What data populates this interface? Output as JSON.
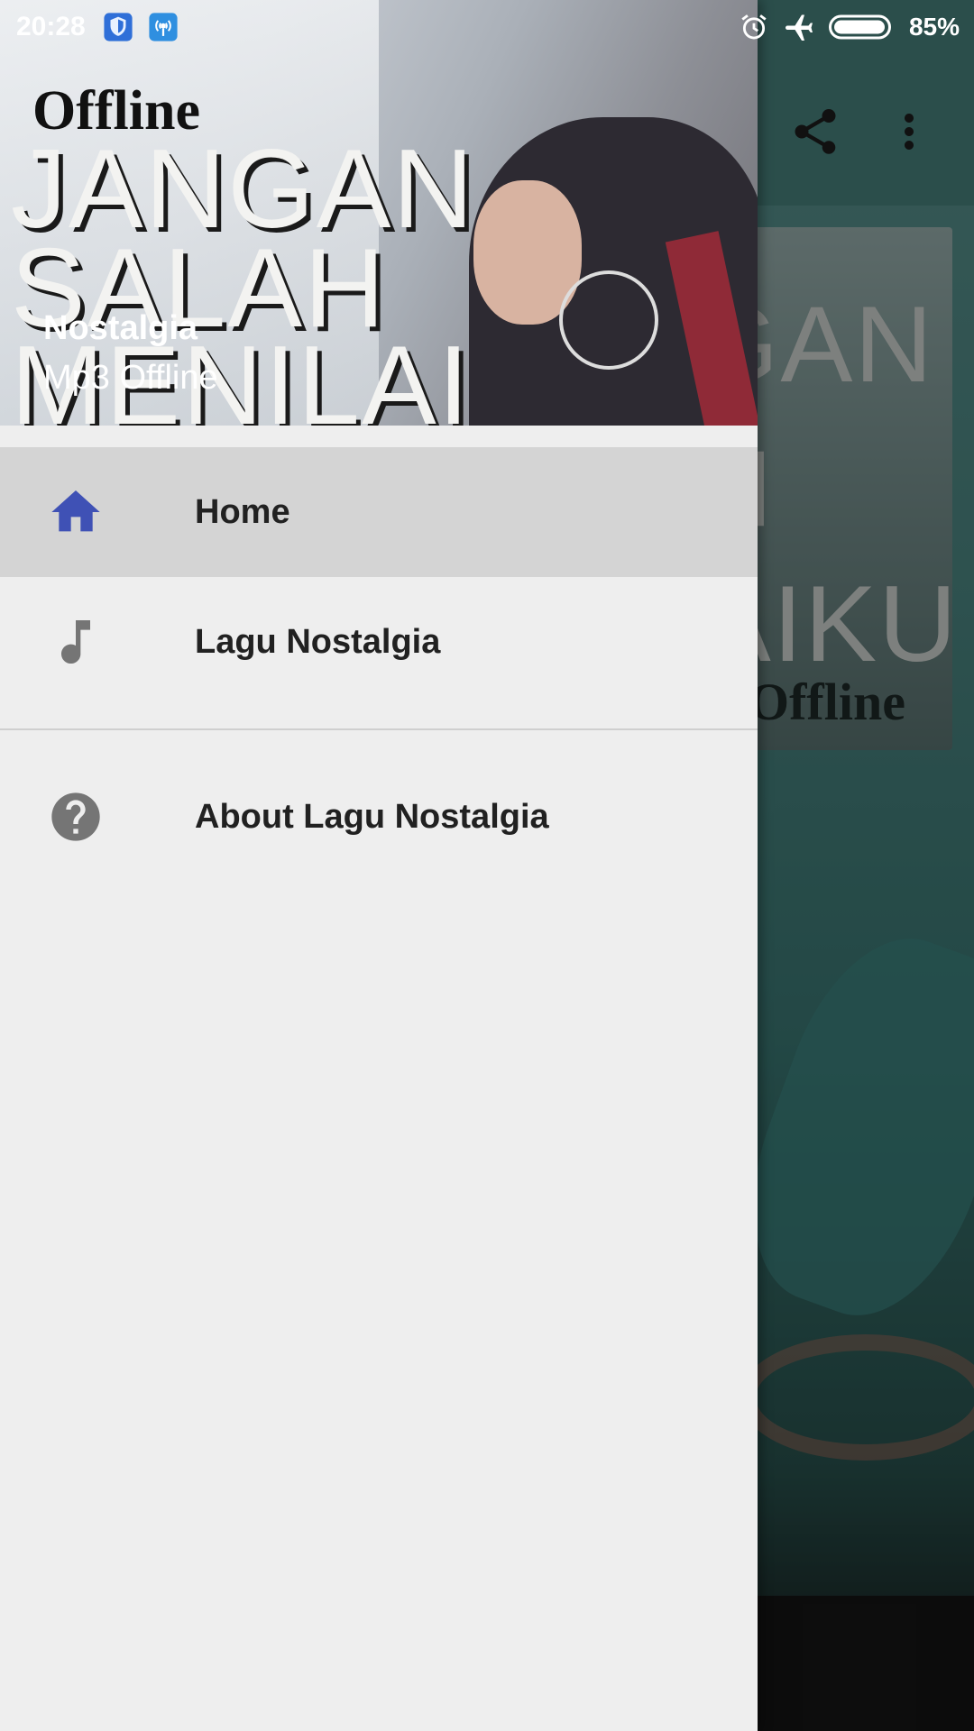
{
  "status_bar": {
    "time": "20:28",
    "battery": "85%",
    "icons": [
      "shield-icon",
      "hotspot-icon",
      "alarm-icon",
      "airplane-icon",
      "battery-icon"
    ]
  },
  "background_app": {
    "actions": [
      "share-icon",
      "more-vert-icon"
    ],
    "card": {
      "lines": [
        "GAN",
        "H",
        "LAIKU"
      ],
      "tag": "Offline"
    }
  },
  "drawer": {
    "header": {
      "banner_tag": "Offline",
      "banner_lines": [
        "JANGAN",
        "SALAH",
        "MENILAI"
      ],
      "app_name": "Nostalgia",
      "app_subtitle": "Mp3 Offline"
    },
    "menu": [
      {
        "label": "Home",
        "icon": "home-icon",
        "active": true
      },
      {
        "label": "Lagu Nostalgia",
        "icon": "music-note-icon",
        "active": false
      },
      {
        "label": "About Lagu Nostalgia",
        "icon": "help-icon",
        "active": false
      }
    ]
  },
  "colors": {
    "accent": "#3f51b5",
    "drawer_bg": "#eeeeee",
    "active_item_bg": "#d4d4d4",
    "icon_gray": "#757575"
  }
}
